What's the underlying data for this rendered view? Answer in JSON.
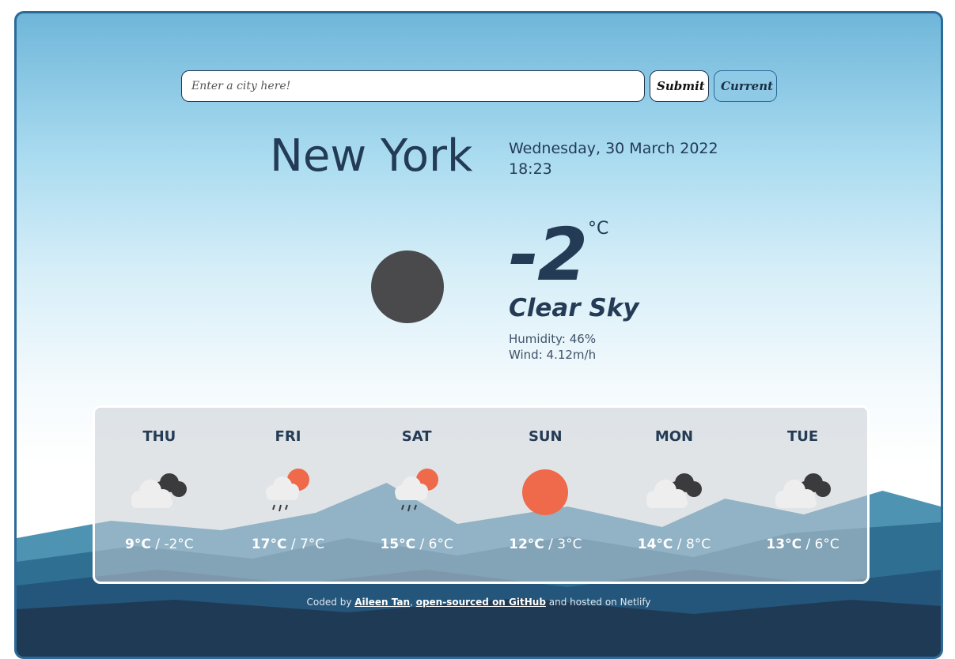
{
  "search": {
    "placeholder": "Enter a city here!",
    "submit_label": "Submit",
    "current_label": "Current"
  },
  "current": {
    "city": "New York",
    "date": "Wednesday, 30 March 2022",
    "time": "18:23",
    "temperature": "-2",
    "unit": "°C",
    "description": "Clear Sky",
    "humidity": "Humidity: 46%",
    "wind": "Wind: 4.12m/h",
    "icon": "clear-night-icon"
  },
  "forecast": [
    {
      "day": "THU",
      "high": "9°C",
      "low": "-2°C",
      "icon": "cloudy-icon"
    },
    {
      "day": "FRI",
      "high": "17°C",
      "low": "7°C",
      "icon": "rain-sun-icon"
    },
    {
      "day": "SAT",
      "high": "15°C",
      "low": "6°C",
      "icon": "rain-sun-icon"
    },
    {
      "day": "SUN",
      "high": "12°C",
      "low": "3°C",
      "icon": "sun-icon"
    },
    {
      "day": "MON",
      "high": "14°C",
      "low": "8°C",
      "icon": "cloudy-icon"
    },
    {
      "day": "TUE",
      "high": "13°C",
      "low": "6°C",
      "icon": "cloudy-icon"
    }
  ],
  "footer": {
    "prefix": "Coded by",
    "author": "Aileen Tan",
    "sep": ",",
    "repo_link": "open-sourced on GitHub",
    "suffix": "and hosted on Netlify"
  },
  "colors": {
    "text": "#243b55",
    "accent": "#8ec9e6",
    "sun": "#ee6a4a"
  }
}
